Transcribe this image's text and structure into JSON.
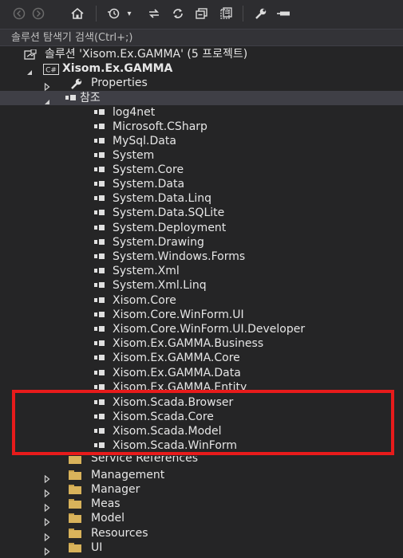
{
  "search": {
    "placeholder": "솔루션 탐색기 검색(Ctrl+;)"
  },
  "toolbar": {
    "icons": [
      "back-icon",
      "forward-icon",
      "home-icon",
      "history-icon",
      "sync-icon",
      "refresh-icon",
      "collapse-all-icon",
      "show-all-files-icon",
      "properties-icon",
      "pin-icon"
    ],
    "caret": "▾"
  },
  "tree": {
    "solution_label": "솔루션 'Xisom.Ex.GAMMA' (5 프로젝트)",
    "project_badge": "C#",
    "project_label": "Xisom.Ex.GAMMA",
    "properties_label": "Properties",
    "references_label": "참조",
    "references": [
      "log4net",
      "Microsoft.CSharp",
      "MySql.Data",
      "System",
      "System.Core",
      "System.Data",
      "System.Data.Linq",
      "System.Data.SQLite",
      "System.Deployment",
      "System.Drawing",
      "System.Windows.Forms",
      "System.Xml",
      "System.Xml.Linq",
      "Xisom.Core",
      "Xisom.Core.WinForm.UI",
      "Xisom.Core.WinForm.UI.Developer",
      "Xisom.Ex.GAMMA.Business",
      "Xisom.Ex.GAMMA.Core",
      "Xisom.Ex.GAMMA.Data",
      "Xisom.Ex.GAMMA.Entity",
      "Xisom.Scada.Browser",
      "Xisom.Scada.Core",
      "Xisom.Scada.Model",
      "Xisom.Scada.WinForm"
    ],
    "service_references_label": "Service References",
    "folders": [
      "Management",
      "Manager",
      "Meas",
      "Model",
      "Resources",
      "UI"
    ]
  },
  "colors": {
    "highlight": "#e81b1b",
    "folder": "#d9b35b",
    "background": "#252526"
  }
}
